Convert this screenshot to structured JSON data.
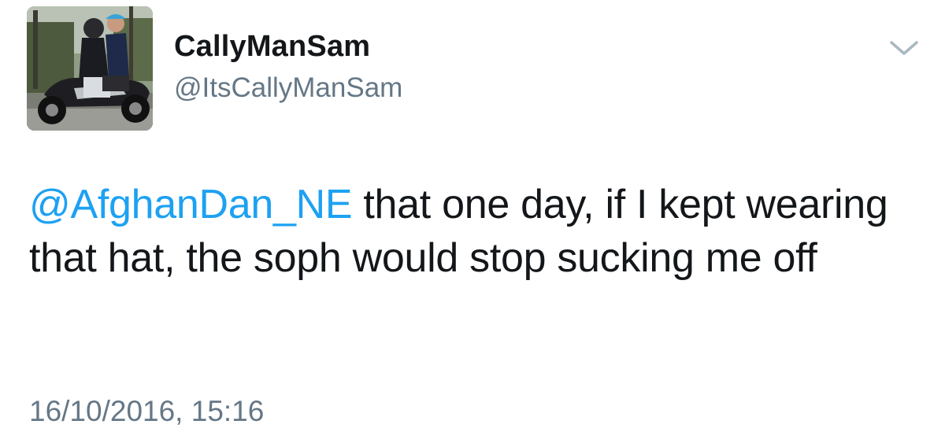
{
  "user": {
    "display_name": "CallyManSam",
    "handle": "@ItsCallyManSam",
    "avatar_icon": "profile-photo-scooter-riders"
  },
  "menu": {
    "icon": "chevron-down-icon"
  },
  "tweet": {
    "mention": "@AfghanDan_NE",
    "text": " that one day, if I kept wearing that hat, the soph would stop sucking me off",
    "timestamp": "16/10/2016, 15:16"
  },
  "colors": {
    "link": "#1da1f2",
    "text": "#14171a",
    "secondary": "#657786"
  }
}
